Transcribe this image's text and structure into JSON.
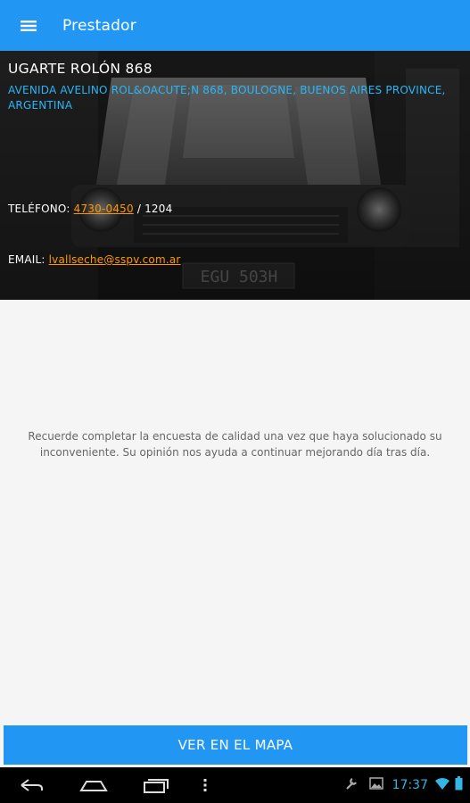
{
  "appbar": {
    "title": "Prestador",
    "menu_icon": "hamburger-menu-icon",
    "background": "#2196f3"
  },
  "provider": {
    "name": "UGARTE ROLÓN 868",
    "address": "AVENIDA AVELINO ROL&OACUTE;N 868, BOULOGNE, BUENOS AIRES PROVINCE, ARGENTINA",
    "phone_label": "TELÉFONO:",
    "phone_number": "4730-0450",
    "phone_extension": "/ 1204",
    "email_label": "EMAIL:",
    "email": "lvallseche@sspv.com.ar",
    "header_image": "car-front-photo"
  },
  "notice": {
    "text": "Recuerde completar la encuesta de calidad una vez que haya solucionado su inconveniente. Su opinión nos ayuda a continuar mejorando día tras día."
  },
  "map_button": {
    "label": "VER EN EL MAPA"
  },
  "system_nav": {
    "back_icon": "back-icon",
    "home_icon": "home-icon",
    "recents_icon": "recent-apps-icon",
    "menu_icon": "overflow-menu-icon",
    "status_icons": [
      "wrench-icon",
      "image-icon"
    ],
    "time": "17:37",
    "wifi_icon": "wifi-icon",
    "battery_icon": "battery-icon"
  },
  "colors": {
    "accent": "#2196f3",
    "address": "#29b6f6",
    "link": "#ff9800",
    "clock": "#33b5e5"
  }
}
